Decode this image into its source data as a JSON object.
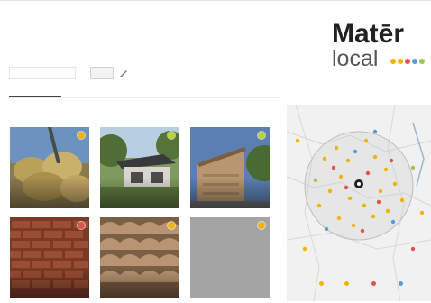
{
  "brand": {
    "name": "Matēr",
    "subtitle": "local",
    "dots": [
      "#f0b400",
      "#f0b400",
      "#e0524b",
      "#5b9bd5",
      "#9ac74f"
    ]
  },
  "search": {
    "select_value": "",
    "button_label": "",
    "edit_icon": "pencil-icon"
  },
  "tabs": [
    {
      "label": "",
      "active": true
    },
    {
      "label": "",
      "active": false
    },
    {
      "label": "",
      "active": false
    },
    {
      "label": "",
      "active": false
    }
  ],
  "section": {
    "heading": ""
  },
  "cards": [
    {
      "title": "",
      "subtitle": "",
      "badge_color": "#f0b400",
      "photo": "bundles-image"
    },
    {
      "title": "",
      "subtitle": "",
      "badge_color": "#b7d531",
      "photo": "house-image"
    },
    {
      "title": "",
      "subtitle": "",
      "badge_color": "#b7d531",
      "photo": "timber-facade-image"
    },
    {
      "title": "",
      "subtitle": "",
      "badge_color": "#e0524b",
      "photo": "brick-wall-image"
    },
    {
      "title": "",
      "subtitle": "",
      "badge_color": "#f0b400",
      "photo": "roof-tiles-image"
    },
    {
      "title": "",
      "subtitle": "",
      "badge_color": "#f0b400",
      "photo": "placeholder-image"
    }
  ],
  "map": {
    "legend": [
      {
        "label": "",
        "color": "#f0b400"
      },
      {
        "label": "",
        "color": "#f0b400"
      },
      {
        "label": "",
        "color": "#e0524b"
      },
      {
        "label": "",
        "color": "#5b9bd5"
      }
    ]
  }
}
